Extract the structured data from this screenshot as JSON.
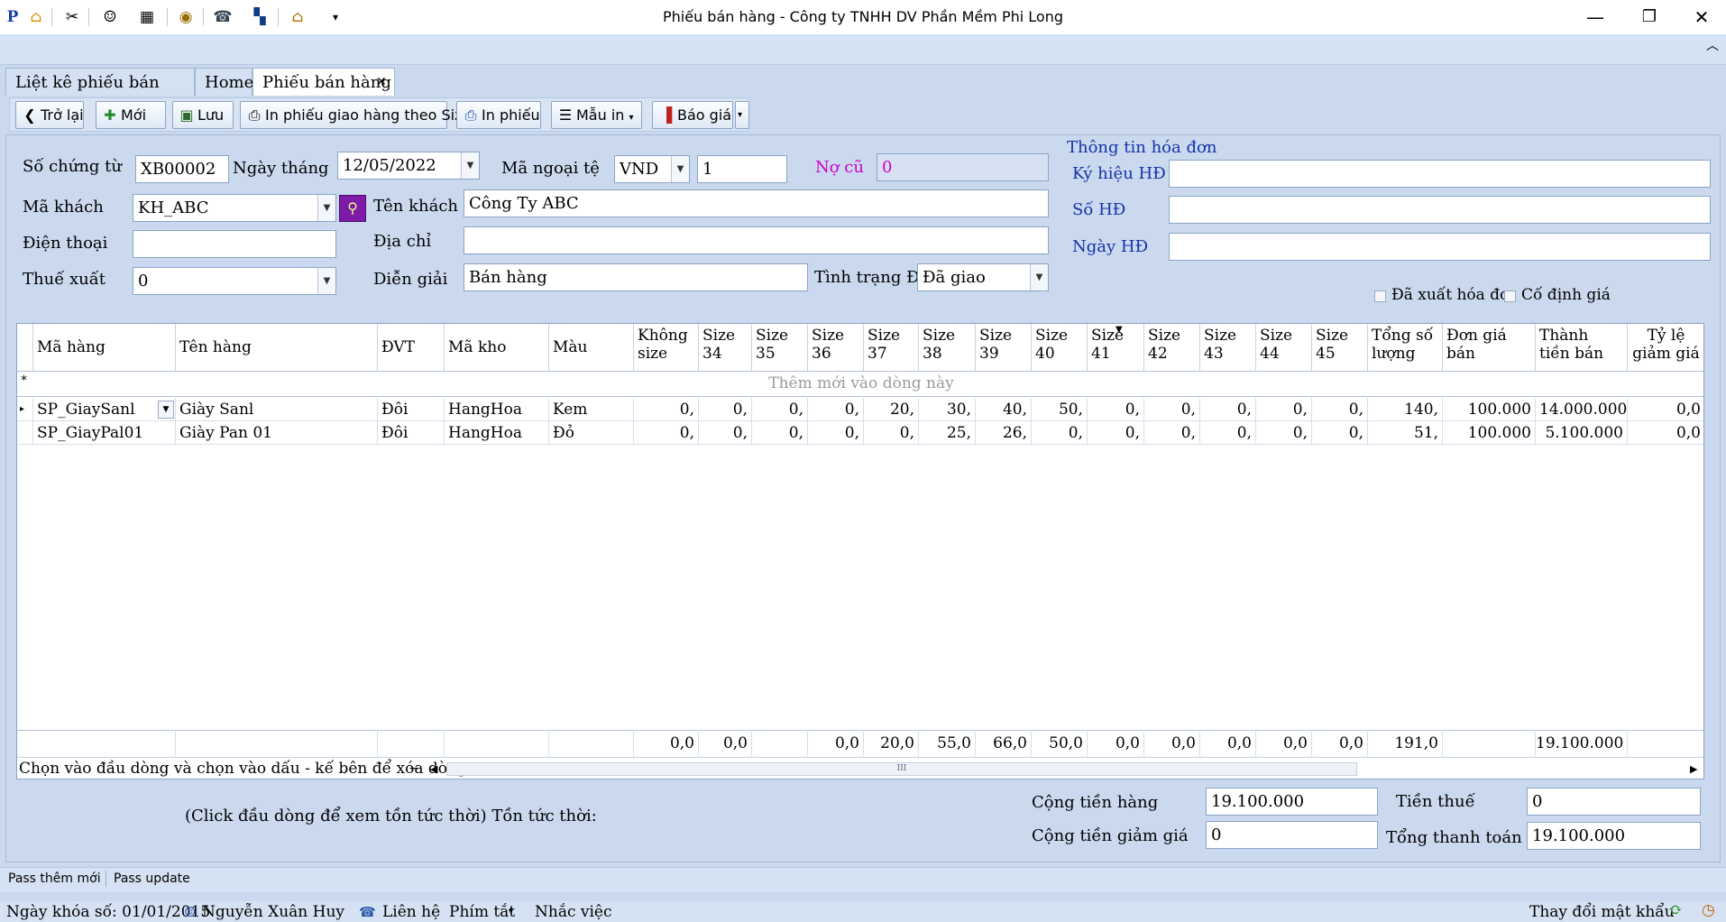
{
  "window": {
    "title": "Phiếu bán hàng - Công ty TNHH DV Phần Mềm Phi Long",
    "minimize": "—",
    "restore": "❐",
    "close": "✕"
  },
  "quick_access": {
    "icons": [
      "logo-icon",
      "home-icon",
      "tools-icon",
      "users-icon",
      "film-icon",
      "eye-icon",
      "phone-icon",
      "grid-icon",
      "house-icon",
      "dropdown-icon"
    ],
    "collapse": "︿"
  },
  "tabs": [
    {
      "label": "Liệt kê phiếu bán hàng"
    },
    {
      "label": "Home"
    },
    {
      "label": "Phiếu bán hàng",
      "close": "✕"
    }
  ],
  "toolbar": {
    "back": "Trở lại",
    "new": "Mới",
    "save": "Lưu",
    "print_size": "In phiếu giao hàng theo Size",
    "print": "In phiếu",
    "template": "Mẫu in",
    "quote": "Báo giá"
  },
  "form": {
    "doc_no_label": "Số chứng từ",
    "doc_no": "XB00002",
    "date_label": "Ngày tháng",
    "date": "12/05/2022",
    "currency_label": "Mã ngoại tệ",
    "currency": "VND",
    "rate": "1",
    "old_debt_label": "Nợ cũ",
    "old_debt": "0",
    "customer_code_label": "Mã khách",
    "customer_code": "KH_ABC",
    "customer_name_label": "Tên khách",
    "customer_name": "Công Ty ABC",
    "phone_label": "Điện thoại",
    "phone": "",
    "address_label": "Địa chỉ",
    "address": "",
    "tax_label": "Thuế xuất",
    "tax": "0",
    "desc_label": "Diễn giải",
    "desc": "Bán hàng",
    "status_label": "Tình trạng ĐH",
    "status": "Đã giao"
  },
  "invoice": {
    "section_label": "Thông tin hóa đơn",
    "symbol_label": "Ký hiệu HĐ",
    "number_label": "Số HĐ",
    "date_label": "Ngày HĐ",
    "symbol": "",
    "number": "",
    "date": "",
    "exported_label": "Đã xuất hóa đơ",
    "fixed_price_label": "Cố định giá"
  },
  "grid": {
    "headers": [
      "Mã hàng",
      "Tên hàng",
      "ĐVT",
      "Mã kho",
      "Màu",
      "Không size",
      "Size 34",
      "Size 35",
      "Size 36",
      "Size 37",
      "Size 38",
      "Size 39",
      "Size 40",
      "Size 41",
      "Size 42",
      "Size 43",
      "Size 44",
      "Size 45",
      "Tổng số lượng",
      "Đơn giá bán",
      "Thành tiền bán",
      "Tỷ lệ giảm giá"
    ],
    "new_row_marker": "*",
    "new_row_text": "Thêm mới vào dòng này",
    "row_indicator": "▸",
    "rows": [
      [
        "SP_GiaySanl",
        "Giày Sanl",
        "Đôi",
        "HangHoa",
        "Kem",
        "0,",
        "0,",
        "0,",
        "0,",
        "20,",
        "30,",
        "40,",
        "50,",
        "0,",
        "0,",
        "0,",
        "0,",
        "0,",
        "140,",
        "100.000",
        "14.000.000",
        "0,0"
      ],
      [
        "SP_GiayPal01",
        "Giày Pan 01",
        "Đôi",
        "HangHoa",
        "Đỏ",
        "0,",
        "0,",
        "0,",
        "0,",
        "0,",
        "25,",
        "26,",
        "0,",
        "0,",
        "0,",
        "0,",
        "0,",
        "0,",
        "51,",
        "100.000",
        "5.100.000",
        "0,0"
      ]
    ],
    "footer": [
      "",
      "",
      "",
      "",
      "",
      "0,0",
      "0,0",
      "",
      "0,0",
      "20,0",
      "55,0",
      "66,0",
      "50,0",
      "0,0",
      "0,0",
      "0,0",
      "0,0",
      "0,0",
      "191,0",
      "",
      "19.100.000",
      ""
    ],
    "hint": "Chọn vào đầu dòng và chọn vào dấu - kế bên để xóa dòng",
    "hint_minus": "−",
    "scroll_left": "◀",
    "scroll_right": "▶",
    "scroll_grip": "III"
  },
  "totals": {
    "stock_hint": "(Click đầu dòng để xem tồn tức thời) Tồn tức thời:",
    "goods_label": "Cộng tiền hàng",
    "goods": "19.100.000",
    "discount_label": "Cộng tiền giảm giá",
    "discount": "0",
    "tax_label": "Tiền thuế",
    "tax": "0",
    "total_label": "Tổng thanh toán",
    "total": "19.100.000"
  },
  "statusbar": {
    "pass_new": "Pass thêm mới",
    "pass_update": "Pass update",
    "lock_date": "Ngày khóa số: 01/01/2015",
    "user": "Nguyễn Xuân Huy",
    "contact": "Liên hệ",
    "shortcut": "Phím tắt",
    "reminder": "Nhắc việc",
    "change_pw": "Thay đổi mật khẩu"
  }
}
